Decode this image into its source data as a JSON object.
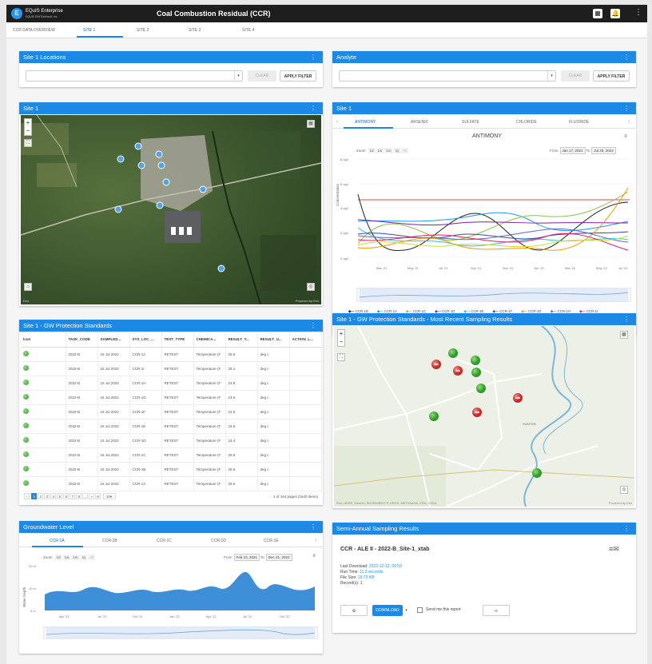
{
  "app": {
    "brand": "EQuIS Enterprise",
    "brand_sub": "EQUIS EIM Earthsoft, Inc.",
    "title": "Coal Combustion Residual (CCR)"
  },
  "tabs": [
    "CCR DATA OVERVIEW",
    "SITE 1",
    "SITE 2",
    "SITE 3",
    "SITE 4"
  ],
  "locations": {
    "title": "Site 1 Locations",
    "clear": "CLEAR",
    "apply": "APPLY FILTER"
  },
  "analyte": {
    "title": "Analyte",
    "clear": "CLEAR",
    "apply": "APPLY FILTER"
  },
  "site_map": {
    "title": "Site 1",
    "attribution_left": "Esri",
    "attribution_right": "Powered by Esri"
  },
  "analyte_chart": {
    "panel_title": "Site 1",
    "tabs": [
      "ANTIMONY",
      "ARSENIC",
      "SULFATE",
      "CHLORIDE",
      "FLUORIDE"
    ],
    "title": "ANTIMONY",
    "zoom_label": "Zoom",
    "zoom": [
      "1d",
      "1w",
      "1m",
      "1y",
      "All"
    ],
    "from_label": "From",
    "from": "Jan 17, 2021",
    "to_label": "To",
    "to": "Jul 20, 2022",
    "ylabel": "Concentration",
    "nav_ticks": [
      "Mar '21",
      "Sep '21",
      "Jan '22",
      "May '22"
    ],
    "legend": [
      "CCR-1B",
      "CCR-1A",
      "CCR-1C",
      "CCR-1D",
      "CCR-1E",
      "CCR-1F",
      "CCR-1G",
      "CCR-1H",
      "CCR-1I",
      "CCR-1J",
      "GW Protection Standards"
    ]
  },
  "gw_table": {
    "title": "Site 1 - GW Protection Standards",
    "columns": [
      "Icon",
      "TASK_CODE",
      "SAMPLED...",
      "SYS_LOC_...",
      "TEST_TYPE",
      "CHEMICA...",
      "RESULT_T...",
      "RESULT_U...",
      "ACTION_L..."
    ],
    "rows": [
      [
        "2022-B",
        "15 Jul 2022",
        "CCR-1J",
        "RETEST",
        "Temperature (F",
        "25.6",
        "deg c",
        ""
      ],
      [
        "2022-B",
        "15 Jul 2022",
        "CCR-1I",
        "RETEST",
        "Temperature (F",
        "25.1",
        "deg c",
        ""
      ],
      [
        "2022-B",
        "15 Jul 2022",
        "CCR-1H",
        "RETEST",
        "Temperature (F",
        "24.8",
        "deg c",
        ""
      ],
      [
        "2022-B",
        "15 Jul 2022",
        "CCR-1G",
        "RETEST",
        "Temperature (F",
        "24.6",
        "deg c",
        ""
      ],
      [
        "2022-B",
        "15 Jul 2022",
        "CCR-1F",
        "RETEST",
        "Temperature (F",
        "24.5",
        "deg c",
        ""
      ],
      [
        "2022-B",
        "15 Jul 2022",
        "CCR-1E",
        "RETEST",
        "Temperature (F",
        "24.5",
        "deg c",
        ""
      ],
      [
        "2022-B",
        "15 Jul 2022",
        "CCR-1D",
        "RETEST",
        "Temperature (F",
        "24.4",
        "deg c",
        ""
      ],
      [
        "2022-B",
        "15 Jul 2022",
        "CCR-1C",
        "RETEST",
        "Temperature (F",
        "25.9",
        "deg c",
        ""
      ],
      [
        "2022-B",
        "15 Jul 2022",
        "CCR-1B",
        "RETEST",
        "Temperature (F",
        "25.6",
        "deg c",
        ""
      ],
      [
        "2022-B",
        "15 Jul 2022",
        "CCR-1A",
        "RETEST",
        "Temperature (F",
        "25.6",
        "deg c",
        ""
      ]
    ],
    "pages": [
      "1",
      "2",
      "3",
      "4",
      "5",
      "6",
      "7",
      "8",
      "...",
      "»",
      "H"
    ],
    "page_size": "10",
    "summary": "1 of 164 pages (1640 items)"
  },
  "recent_map": {
    "title": "Site 1 - GW Protection Standards - Most Recent Sampling Results",
    "attribution_left": "Esri, HERE, Garmin, INCREMENT P, USGS, METI/NASA, EPA, USDA",
    "attribution_right": "Powered by Esri",
    "place": "SUMTER"
  },
  "groundwater": {
    "title": "Groundwater Level",
    "tabs": [
      "CCR-1A",
      "CCR-1B",
      "CCR-1C",
      "CCR-1D",
      "CCR-1E"
    ],
    "zoom_label": "Zoom",
    "zoom": [
      "1d",
      "1w",
      "1m",
      "1y",
      "All"
    ],
    "from_label": "From",
    "from": "Feb 10, 2021",
    "to_label": "To",
    "to": "Dec 21, 2022",
    "ylabel": "Water Depth"
  },
  "semi_annual": {
    "title": "Semi-Annual Sampling Results",
    "report": "CCR - ALE II - 2022-B_Site-1_xtab",
    "last_download_label": "Last Download:",
    "last_download": "2022-12-12, 09:59",
    "run_time_label": "Run Time:",
    "run_time": "11.3 seconds",
    "file_size_label": "File Size:",
    "file_size": "29.73 KB",
    "records_label": "Record(s):",
    "records": "1",
    "download": "DOWNLOAD",
    "send_me": "Send me this report"
  },
  "colors": {
    "accent": "#1e88e5",
    "topbar": "#1e1e1e"
  }
}
